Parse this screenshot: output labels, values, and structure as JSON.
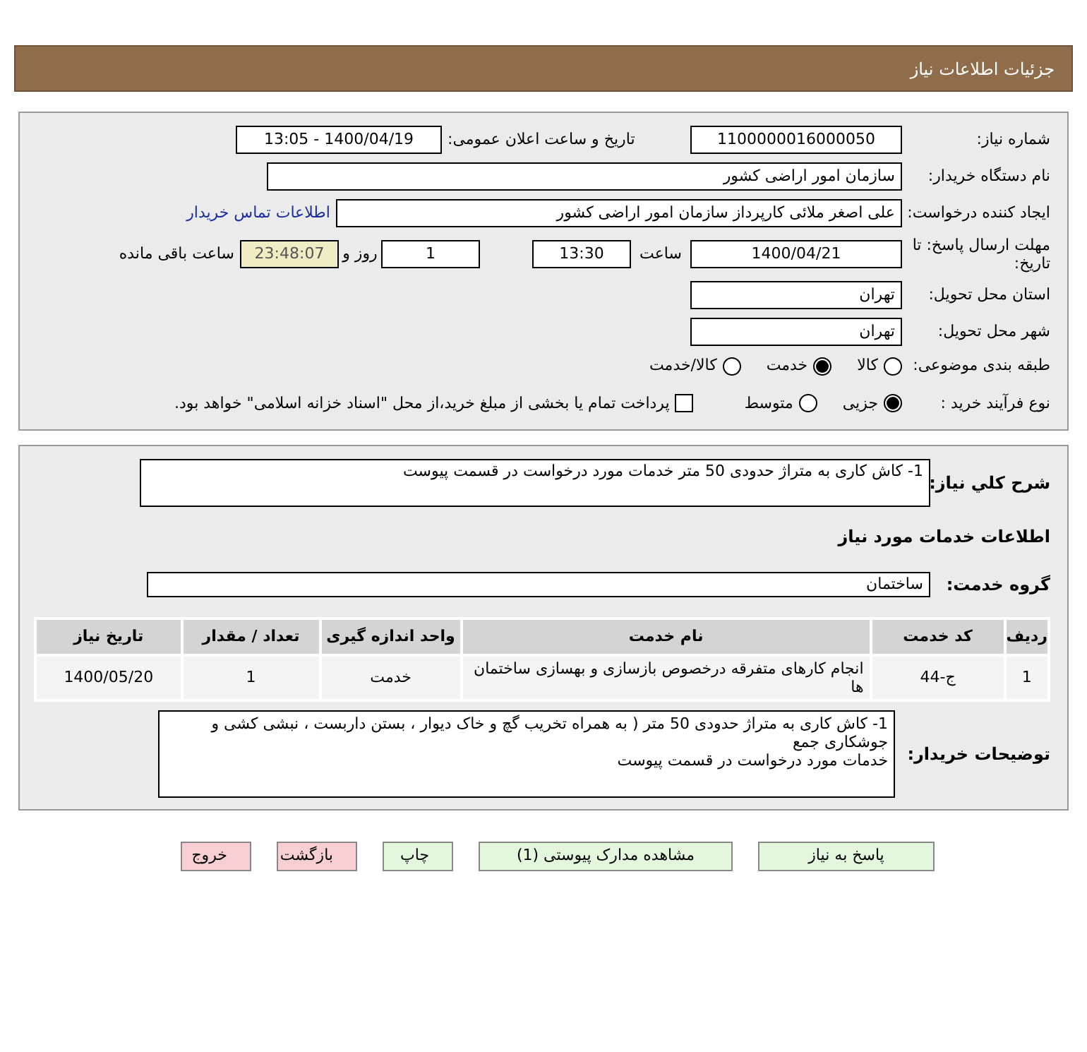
{
  "title": "جزئیات اطلاعات نیاز",
  "need_number": {
    "label": "شماره نیاز:",
    "value": "1100000016000050"
  },
  "announce": {
    "label": "تاریخ و ساعت اعلان عمومی:",
    "value": "1400/04/19 - 13:05"
  },
  "buyer_org": {
    "label": "نام دستگاه خریدار:",
    "value": "سازمان امور اراضی کشور"
  },
  "creator": {
    "label": "ایجاد کننده درخواست:",
    "value": "علی اصغر ملائی کارپرداز سازمان امور اراضی کشور"
  },
  "contact_link": "اطلاعات تماس خریدار",
  "deadline": {
    "label": "مهلت ارسال پاسخ: تا تاریخ:",
    "date": "1400/04/21",
    "time_label": "ساعت",
    "time": "13:30",
    "days": "1",
    "days_label": "روز و",
    "remaining": "23:48:07",
    "remaining_label": "ساعت باقی مانده"
  },
  "province": {
    "label": "استان محل تحویل:",
    "value": "تهران"
  },
  "city": {
    "label": "شهر محل تحویل:",
    "value": "تهران"
  },
  "category": {
    "label": "طبقه بندی موضوعی:",
    "options": [
      {
        "label": "کالا",
        "selected": false
      },
      {
        "label": "خدمت",
        "selected": true
      },
      {
        "label": "کالا/خدمت",
        "selected": false
      }
    ]
  },
  "process": {
    "label": "نوع فرآیند خرید :",
    "options": [
      {
        "label": "جزیی",
        "selected": true
      },
      {
        "label": "متوسط",
        "selected": false
      }
    ],
    "payment": {
      "checked": false,
      "label": "پرداخت تمام یا بخشی از مبلغ خرید،از محل \"اسناد خزانه اسلامی\" خواهد بود."
    }
  },
  "summary": {
    "label": "شرح کلي نياز:",
    "value": "1- کاش کاری به متراژ حدودی 50 متر خدمات مورد درخواست در قسمت پیوست"
  },
  "services_heading": "اطلاعات خدمات مورد نياز",
  "service_group": {
    "label": "گروه خدمت:",
    "value": "ساختمان"
  },
  "table": {
    "columns": [
      "رديف",
      "کد خدمت",
      "نام خدمت",
      "واحد اندازه گيری",
      "تعداد / مقدار",
      "تاريخ نياز"
    ],
    "rows": [
      [
        "1",
        "ج-44",
        "انجام کارهای متفرقه درخصوص بازسازی و بهسازی ساختمان ها",
        "خدمت",
        "1",
        "1400/05/20"
      ]
    ]
  },
  "buyer_notes": {
    "label": "توضیحات خریدار:",
    "lines": [
      "1- کاش کاری به متراژ حدودی 50 متر ( به همراه تخریب گچ و خاک دیوار ، بستن داربست ، نبشی کشی و جوشکاری جمع",
      "خدمات مورد درخواست در قسمت پیوست"
    ]
  },
  "buttons": [
    {
      "label": "پاسخ به نياز",
      "kind": "normal"
    },
    {
      "label": "مشاهده مدارک پیوستی (1)",
      "kind": "normal"
    },
    {
      "label": "چاپ",
      "kind": "normal"
    },
    {
      "label": "بازگشت",
      "kind": "danger"
    },
    {
      "label": "خروج",
      "kind": "danger"
    }
  ]
}
